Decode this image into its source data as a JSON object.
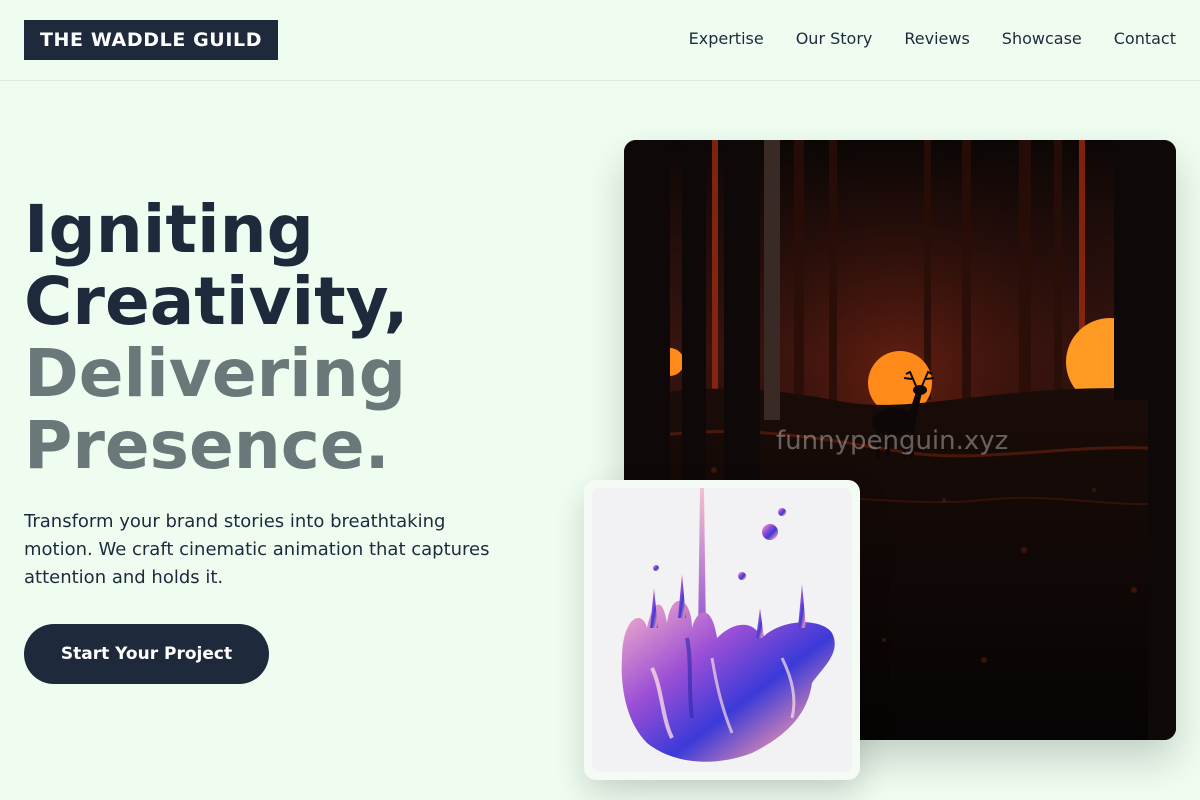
{
  "brand": {
    "name": "THE WADDLE GUILD"
  },
  "nav": {
    "items": [
      {
        "label": "Expertise"
      },
      {
        "label": "Our Story"
      },
      {
        "label": "Reviews"
      },
      {
        "label": "Showcase"
      },
      {
        "label": "Contact"
      }
    ]
  },
  "hero": {
    "title_line1": "Igniting",
    "title_line2": "Creativity,",
    "title_line3": "Delivering",
    "title_line4": "Presence.",
    "subtitle": "Transform your brand stories into breathtaking motion. We craft cinematic animation that captures attention and holds it.",
    "cta_label": "Start Your Project"
  },
  "showcase": {
    "watermark": "funnypenguin.xyz"
  },
  "colors": {
    "background": "#effdf1",
    "primary": "#1e293b",
    "muted_text": "#6b7879",
    "orange": "#ff8a1a"
  }
}
